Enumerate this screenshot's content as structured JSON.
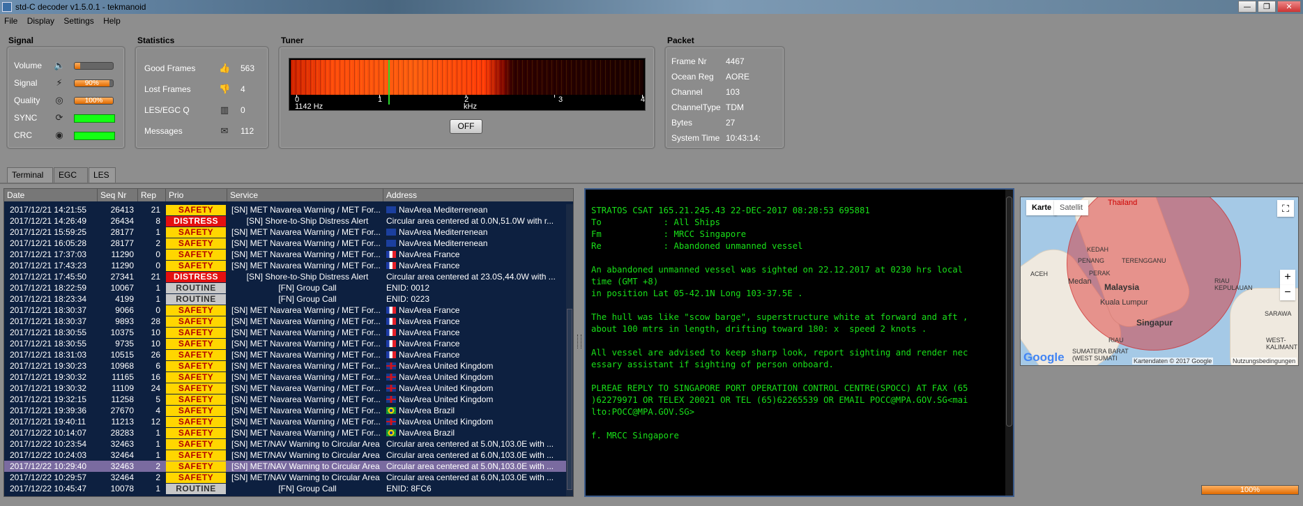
{
  "window": {
    "title": "std-C decoder v1.5.0.1 - tekmanoid"
  },
  "menu": [
    "File",
    "Display",
    "Settings",
    "Help"
  ],
  "signal": {
    "heading": "Signal",
    "volume_label": "Volume",
    "volume_level": 0.15,
    "signal_label": "Signal",
    "signal_value": "90%",
    "signal_level": 0.9,
    "quality_label": "Quality",
    "quality_value": "100%",
    "quality_level": 1.0,
    "sync_label": "SYNC",
    "crc_label": "CRC",
    "led_color": "#14ff14"
  },
  "statistics": {
    "heading": "Statistics",
    "good_frames_label": "Good Frames",
    "good_frames": "563",
    "lost_frames_label": "Lost Frames",
    "lost_frames": "4",
    "les_egc_label": "LES/EGC Q",
    "les_egc": "0",
    "messages_label": "Messages",
    "messages": "112"
  },
  "tuner": {
    "heading": "Tuner",
    "freq": "1142 Hz",
    "unit": "kHz",
    "ticks": [
      "0",
      "1",
      "2",
      "3",
      "4"
    ],
    "button_label": "OFF"
  },
  "packet": {
    "heading": "Packet",
    "fields": [
      {
        "label": "Frame Nr",
        "value": "4467"
      },
      {
        "label": "Ocean Reg",
        "value": "AORE"
      },
      {
        "label": "Channel",
        "value": "103"
      },
      {
        "label": "ChannelType",
        "value": "TDM"
      },
      {
        "label": "Bytes",
        "value": "27"
      },
      {
        "label": "System Time",
        "value": "10:43:14:"
      }
    ]
  },
  "tabs": [
    "Terminal",
    "EGC",
    "LES"
  ],
  "active_tab": "EGC",
  "table": {
    "columns": [
      "Date",
      "Seq Nr",
      "Rep",
      "Prio",
      "Service",
      "Address"
    ],
    "rows": [
      {
        "date": "2017/12/21 14:21:55",
        "seq": "26413",
        "rep": "21",
        "prio": "SAFETY",
        "service": "[SN] MET Navarea Warning / MET For...",
        "flag": "eu",
        "address": "NavArea Mediterrenean"
      },
      {
        "date": "2017/12/21 14:26:49",
        "seq": "26434",
        "rep": "8",
        "prio": "DISTRESS",
        "service": "[SN] Shore-to-Ship Distress Alert",
        "flag": "",
        "address": "Circular area centered at 0.0N,51.0W with r..."
      },
      {
        "date": "2017/12/21 15:59:25",
        "seq": "28177",
        "rep": "1",
        "prio": "SAFETY",
        "service": "[SN] MET Navarea Warning / MET For...",
        "flag": "eu",
        "address": "NavArea Mediterrenean"
      },
      {
        "date": "2017/12/21 16:05:28",
        "seq": "28177",
        "rep": "2",
        "prio": "SAFETY",
        "service": "[SN] MET Navarea Warning / MET For...",
        "flag": "eu",
        "address": "NavArea Mediterrenean"
      },
      {
        "date": "2017/12/21 17:37:03",
        "seq": "11290",
        "rep": "0",
        "prio": "SAFETY",
        "service": "[SN] MET Navarea Warning / MET For...",
        "flag": "fr",
        "address": "NavArea France"
      },
      {
        "date": "2017/12/21 17:43:23",
        "seq": "11290",
        "rep": "0",
        "prio": "SAFETY",
        "service": "[SN] MET Navarea Warning / MET For...",
        "flag": "fr",
        "address": "NavArea France"
      },
      {
        "date": "2017/12/21 17:45:50",
        "seq": "27341",
        "rep": "21",
        "prio": "DISTRESS",
        "service": "[SN] Shore-to-Ship Distress Alert",
        "flag": "",
        "address": "Circular area centered at 23.0S,44.0W with ..."
      },
      {
        "date": "2017/12/21 18:22:59",
        "seq": "10067",
        "rep": "1",
        "prio": "ROUTINE",
        "service": "[FN] Group Call",
        "flag": "",
        "address": "ENID: 0012"
      },
      {
        "date": "2017/12/21 18:23:34",
        "seq": "4199",
        "rep": "1",
        "prio": "ROUTINE",
        "service": "[FN] Group Call",
        "flag": "",
        "address": "ENID: 0223"
      },
      {
        "date": "2017/12/21 18:30:37",
        "seq": "9066",
        "rep": "0",
        "prio": "SAFETY",
        "service": "[SN] MET Navarea Warning / MET For...",
        "flag": "fr",
        "address": "NavArea France"
      },
      {
        "date": "2017/12/21 18:30:37",
        "seq": "9893",
        "rep": "28",
        "prio": "SAFETY",
        "service": "[SN] MET Navarea Warning / MET For...",
        "flag": "fr",
        "address": "NavArea France"
      },
      {
        "date": "2017/12/21 18:30:55",
        "seq": "10375",
        "rep": "10",
        "prio": "SAFETY",
        "service": "[SN] MET Navarea Warning / MET For...",
        "flag": "fr",
        "address": "NavArea France"
      },
      {
        "date": "2017/12/21 18:30:55",
        "seq": "9735",
        "rep": "10",
        "prio": "SAFETY",
        "service": "[SN] MET Navarea Warning / MET For...",
        "flag": "fr",
        "address": "NavArea France"
      },
      {
        "date": "2017/12/21 18:31:03",
        "seq": "10515",
        "rep": "26",
        "prio": "SAFETY",
        "service": "[SN] MET Navarea Warning / MET For...",
        "flag": "fr",
        "address": "NavArea France"
      },
      {
        "date": "2017/12/21 19:30:23",
        "seq": "10968",
        "rep": "6",
        "prio": "SAFETY",
        "service": "[SN] MET Navarea Warning / MET For...",
        "flag": "uk",
        "address": "NavArea United Kingdom"
      },
      {
        "date": "2017/12/21 19:30:32",
        "seq": "11165",
        "rep": "16",
        "prio": "SAFETY",
        "service": "[SN] MET Navarea Warning / MET For...",
        "flag": "uk",
        "address": "NavArea United Kingdom"
      },
      {
        "date": "2017/12/21 19:30:32",
        "seq": "11109",
        "rep": "24",
        "prio": "SAFETY",
        "service": "[SN] MET Navarea Warning / MET For...",
        "flag": "uk",
        "address": "NavArea United Kingdom"
      },
      {
        "date": "2017/12/21 19:32:15",
        "seq": "11258",
        "rep": "5",
        "prio": "SAFETY",
        "service": "[SN] MET Navarea Warning / MET For...",
        "flag": "uk",
        "address": "NavArea United Kingdom"
      },
      {
        "date": "2017/12/21 19:39:36",
        "seq": "27670",
        "rep": "4",
        "prio": "SAFETY",
        "service": "[SN] MET Navarea Warning / MET For...",
        "flag": "br",
        "address": "NavArea Brazil"
      },
      {
        "date": "2017/12/21 19:40:11",
        "seq": "11213",
        "rep": "12",
        "prio": "SAFETY",
        "service": "[SN] MET Navarea Warning / MET For...",
        "flag": "uk",
        "address": "NavArea United Kingdom"
      },
      {
        "date": "2017/12/22 10:14:07",
        "seq": "28283",
        "rep": "1",
        "prio": "SAFETY",
        "service": "[SN] MET Navarea Warning / MET For...",
        "flag": "br",
        "address": "NavArea Brazil"
      },
      {
        "date": "2017/12/22 10:23:54",
        "seq": "32463",
        "rep": "1",
        "prio": "SAFETY",
        "service": "[SN] MET/NAV Warning to Circular Area",
        "flag": "",
        "address": "Circular area centered at 5.0N,103.0E with ..."
      },
      {
        "date": "2017/12/22 10:24:03",
        "seq": "32464",
        "rep": "1",
        "prio": "SAFETY",
        "service": "[SN] MET/NAV Warning to Circular Area",
        "flag": "",
        "address": "Circular area centered at 6.0N,103.0E with ..."
      },
      {
        "date": "2017/12/22 10:29:40",
        "seq": "32463",
        "rep": "2",
        "prio": "SAFETY",
        "service": "[SN] MET/NAV Warning to Circular Area",
        "flag": "",
        "address": "Circular area centered at 5.0N,103.0E with ...",
        "selected": true
      },
      {
        "date": "2017/12/22 10:29:57",
        "seq": "32464",
        "rep": "2",
        "prio": "SAFETY",
        "service": "[SN] MET/NAV Warning to Circular Area",
        "flag": "",
        "address": "Circular area centered at 6.0N,103.0E with ..."
      },
      {
        "date": "2017/12/22 10:45:47",
        "seq": "10078",
        "rep": "1",
        "prio": "ROUTINE",
        "service": "[FN] Group Call",
        "flag": "",
        "address": "ENID: 8FC6"
      }
    ]
  },
  "message": {
    "text": "STRATOS CSAT 165.21.245.43 22-DEC-2017 08:28:53 695881\nTo            : All Ships\nFm            : MRCC Singapore\nRe            : Abandoned unmanned vessel\n\nAn abandoned unmanned vessel was sighted on 22.12.2017 at 0230 hrs local\ntime (GMT +8)\nin position Lat 05-42.1N Long 103-37.5E .\n\nThe hull was like \"scow barge\", superstructure white at forward and aft ,\nabout 100 mtrs in length, drifting toward 180: x  speed 2 knots .\n\nAll vessel are advised to keep sharp look, report sighting and render nec\nessary assistant if sighting of person onboard.\n\nPLREAE REPLY TO SINGAPORE PORT OPERATION CONTROL CENTRE(SPOCC) AT FAX (65\n)62279971 OR TELEX 20021 OR TEL (65)62265539 OR EMAIL POCC@MPA.GOV.SG<mai\nlto:POCC@MPA.GOV.SG>\n\nf. MRCC Singapore",
    "color": "#19e019"
  },
  "map": {
    "tab_map": "Karte",
    "tab_satellite": "Satellit",
    "labels": [
      "Thailand",
      "KEDAH",
      "PENANG",
      "TERENGGANU",
      "PERAK",
      "ACEH",
      "Medan",
      "Malaysia",
      "Kuala Lumpur",
      "RIAU KEPULAUAN",
      "Singapur",
      "SARAWA",
      "RIAU",
      "SUMATERA BARAT (WEST SUMATI",
      "WEST-KALIMANT"
    ],
    "attribution": "Kartendaten © 2017 Google",
    "terms": "Nutzungsbedingungen",
    "logo": "Google",
    "zoom_in": "+",
    "zoom_out": "−"
  },
  "status": {
    "progress": "100%"
  }
}
